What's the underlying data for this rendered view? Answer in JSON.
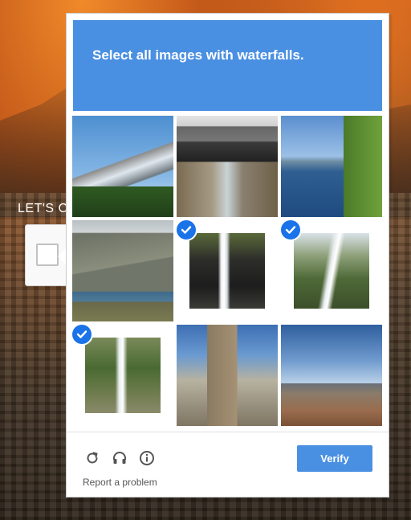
{
  "background": {
    "partial_heading": "LET'S C"
  },
  "captcha": {
    "instruction": "Select all images with waterfalls.",
    "accent_color": "#4a90e2",
    "tiles": [
      {
        "name": "mountain-forest",
        "selected": false
      },
      {
        "name": "bridge-stream",
        "selected": false
      },
      {
        "name": "river-lake",
        "selected": false
      },
      {
        "name": "coastal-hills",
        "selected": false
      },
      {
        "name": "waterfall-cliff",
        "selected": true
      },
      {
        "name": "waterfall-green",
        "selected": true
      },
      {
        "name": "waterfall-rocky",
        "selected": true
      },
      {
        "name": "castle-ruin",
        "selected": false
      },
      {
        "name": "mountain-valley",
        "selected": false
      }
    ],
    "footer": {
      "reload_icon": "reload-icon",
      "audio_icon": "headphones-icon",
      "info_icon": "info-icon",
      "report_label": "Report a problem",
      "verify_label": "Verify"
    }
  }
}
